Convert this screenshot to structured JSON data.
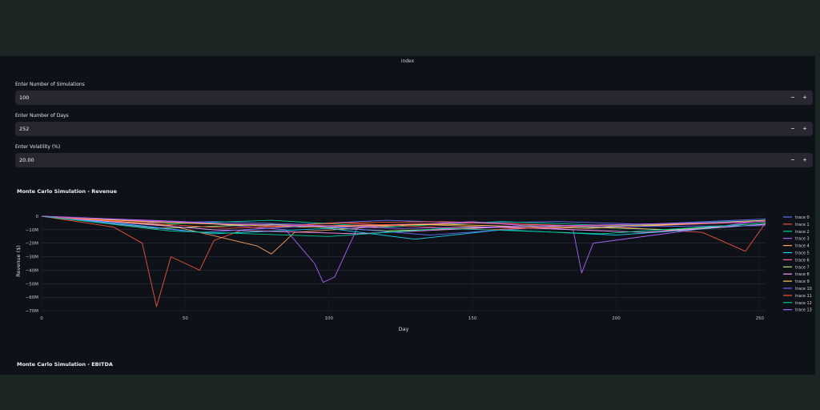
{
  "app": {
    "title": "index"
  },
  "inputs": [
    {
      "label": "Enter Number of Simulations",
      "value": "100"
    },
    {
      "label": "Enter Number of Days",
      "value": "252"
    },
    {
      "label": "Enter Volatility (%)",
      "value": "20.00"
    }
  ],
  "stepper": {
    "minus": "−",
    "plus": "+"
  },
  "revenue_chart": {
    "title": "Monte Carlo Simulation - Revenue"
  },
  "ebitda_chart": {
    "title": "Monte Carlo Simulation - EBITDA"
  },
  "chart_data": {
    "type": "line",
    "title": "Monte Carlo Simulation - Revenue",
    "xlabel": "Day",
    "ylabel": "Revenue ($)",
    "xlim": [
      0,
      252
    ],
    "ylim": [
      -70000000,
      0
    ],
    "x_ticks": [
      "0",
      "50",
      "100",
      "150",
      "200",
      "250"
    ],
    "y_ticks": [
      "0",
      "−10M",
      "−20M",
      "−30M",
      "−40M",
      "−50M",
      "−60M",
      "−70M"
    ],
    "x_tick_values": [
      0,
      50,
      100,
      150,
      200,
      250
    ],
    "y_tick_values": [
      0,
      -10000000,
      -20000000,
      -30000000,
      -40000000,
      -50000000,
      -60000000,
      -70000000
    ],
    "grid": true,
    "legend_position": "right",
    "series": [
      {
        "name": "trace 0",
        "color": "#636efa",
        "points": [
          [
            0,
            0
          ],
          [
            30,
            -5000000
          ],
          [
            60,
            -4000000
          ],
          [
            90,
            -6000000
          ],
          [
            120,
            -3000000
          ],
          [
            150,
            -5000000
          ],
          [
            180,
            -4000000
          ],
          [
            210,
            -6000000
          ],
          [
            252,
            -2000000
          ]
        ]
      },
      {
        "name": "trace 1",
        "color": "#ef553b",
        "points": [
          [
            0,
            0
          ],
          [
            25,
            -8000000
          ],
          [
            35,
            -20000000
          ],
          [
            40,
            -67000000
          ],
          [
            45,
            -30000000
          ],
          [
            55,
            -40000000
          ],
          [
            60,
            -18000000
          ],
          [
            70,
            -10000000
          ],
          [
            100,
            -5000000
          ],
          [
            140,
            -4000000
          ],
          [
            200,
            -8000000
          ],
          [
            230,
            -12000000
          ],
          [
            245,
            -26000000
          ],
          [
            252,
            -5000000
          ]
        ]
      },
      {
        "name": "trace 2",
        "color": "#00cc96",
        "points": [
          [
            0,
            0
          ],
          [
            40,
            -6000000
          ],
          [
            80,
            -3000000
          ],
          [
            120,
            -8000000
          ],
          [
            160,
            -4000000
          ],
          [
            200,
            -7000000
          ],
          [
            252,
            -3000000
          ]
        ]
      },
      {
        "name": "trace 3",
        "color": "#ab63fa",
        "points": [
          [
            0,
            0
          ],
          [
            50,
            -4000000
          ],
          [
            85,
            -10000000
          ],
          [
            95,
            -35000000
          ],
          [
            98,
            -49000000
          ],
          [
            102,
            -45000000
          ],
          [
            110,
            -8000000
          ],
          [
            150,
            -4000000
          ],
          [
            185,
            -10000000
          ],
          [
            188,
            -42000000
          ],
          [
            192,
            -20000000
          ],
          [
            252,
            -3000000
          ]
        ]
      },
      {
        "name": "trace 4",
        "color": "#ffa15a",
        "points": [
          [
            0,
            0
          ],
          [
            45,
            -7000000
          ],
          [
            75,
            -22000000
          ],
          [
            80,
            -28000000
          ],
          [
            88,
            -12000000
          ],
          [
            130,
            -6000000
          ],
          [
            170,
            -9000000
          ],
          [
            252,
            -4000000
          ]
        ]
      },
      {
        "name": "trace 5",
        "color": "#19d3f3",
        "points": [
          [
            0,
            0
          ],
          [
            30,
            -6000000
          ],
          [
            60,
            -13000000
          ],
          [
            100,
            -9000000
          ],
          [
            130,
            -17000000
          ],
          [
            160,
            -10000000
          ],
          [
            200,
            -14000000
          ],
          [
            252,
            -6000000
          ]
        ]
      },
      {
        "name": "trace 6",
        "color": "#ff6692",
        "points": [
          [
            0,
            0
          ],
          [
            50,
            -5000000
          ],
          [
            100,
            -7000000
          ],
          [
            150,
            -5000000
          ],
          [
            200,
            -8000000
          ],
          [
            252,
            -4000000
          ]
        ]
      },
      {
        "name": "trace 7",
        "color": "#b6e880",
        "points": [
          [
            0,
            0
          ],
          [
            40,
            -9000000
          ],
          [
            80,
            -6000000
          ],
          [
            120,
            -11000000
          ],
          [
            170,
            -7000000
          ],
          [
            220,
            -10000000
          ],
          [
            252,
            -5000000
          ]
        ]
      },
      {
        "name": "trace 8",
        "color": "#ff97ff",
        "points": [
          [
            0,
            0
          ],
          [
            60,
            -10000000
          ],
          [
            110,
            -13000000
          ],
          [
            160,
            -8000000
          ],
          [
            210,
            -12000000
          ],
          [
            252,
            -6000000
          ]
        ]
      },
      {
        "name": "trace 9",
        "color": "#fecb52",
        "points": [
          [
            0,
            0
          ],
          [
            35,
            -4000000
          ],
          [
            90,
            -8000000
          ],
          [
            140,
            -6000000
          ],
          [
            190,
            -9000000
          ],
          [
            252,
            -3000000
          ]
        ]
      },
      {
        "name": "trace 10",
        "color": "#636efa",
        "points": [
          [
            0,
            0
          ],
          [
            55,
            -12000000
          ],
          [
            95,
            -7000000
          ],
          [
            135,
            -14000000
          ],
          [
            175,
            -8000000
          ],
          [
            252,
            -7000000
          ]
        ]
      },
      {
        "name": "trace 11",
        "color": "#ef553b",
        "points": [
          [
            0,
            0
          ],
          [
            65,
            -9000000
          ],
          [
            105,
            -5000000
          ],
          [
            155,
            -10000000
          ],
          [
            205,
            -6000000
          ],
          [
            252,
            -4000000
          ]
        ]
      },
      {
        "name": "trace 12",
        "color": "#00cc96",
        "points": [
          [
            0,
            0
          ],
          [
            45,
            -11000000
          ],
          [
            100,
            -15000000
          ],
          [
            140,
            -9000000
          ],
          [
            195,
            -13000000
          ],
          [
            252,
            -5000000
          ]
        ]
      },
      {
        "name": "trace 13",
        "color": "#ab63fa",
        "points": [
          [
            0,
            0
          ],
          [
            70,
            -6000000
          ],
          [
            125,
            -9000000
          ],
          [
            180,
            -7000000
          ],
          [
            252,
            -4000000
          ]
        ]
      }
    ]
  }
}
